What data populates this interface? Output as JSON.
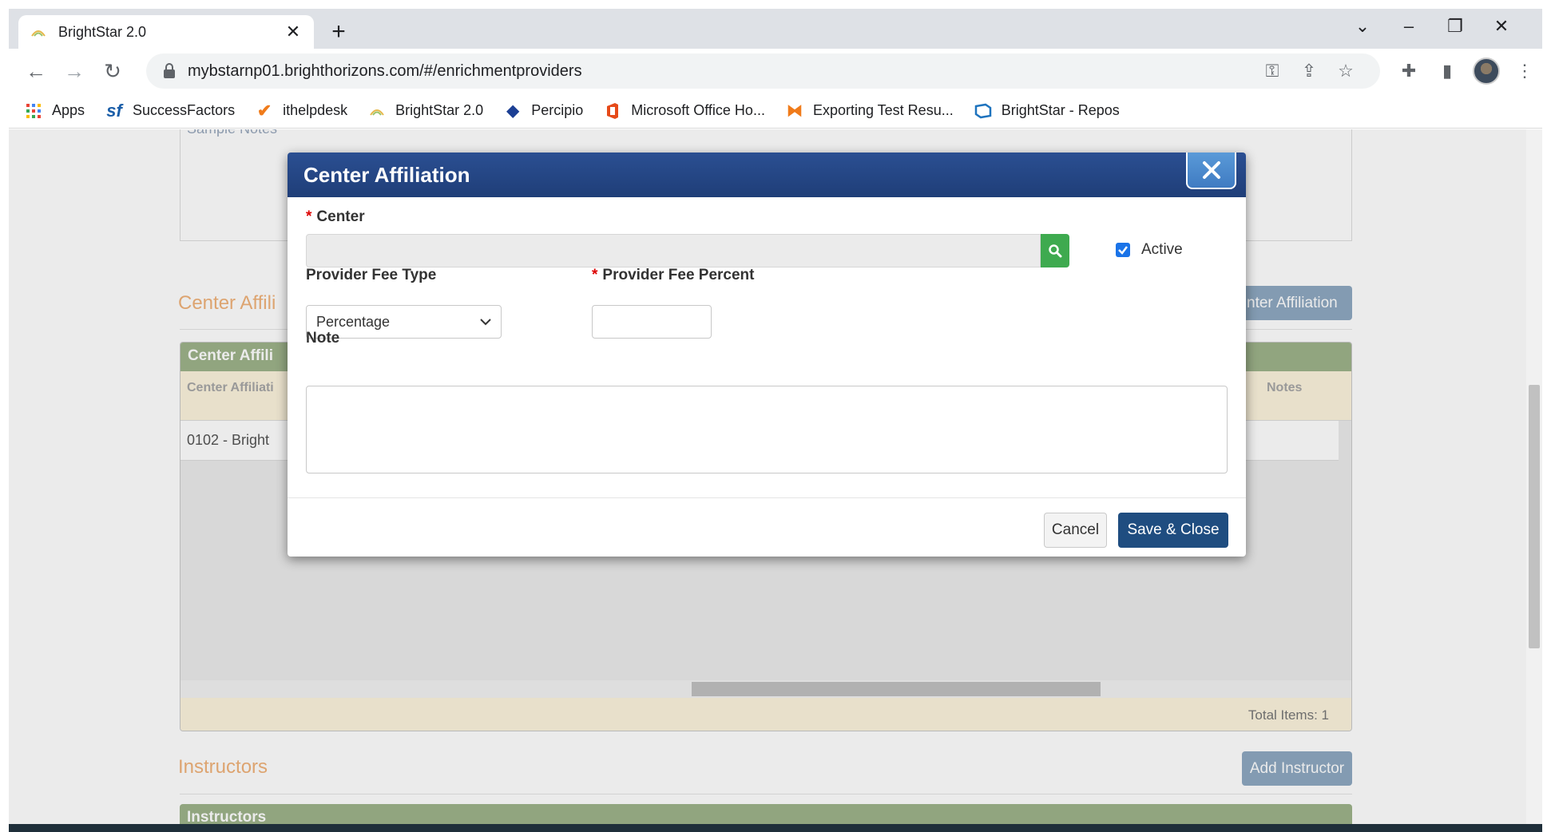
{
  "browser": {
    "tab_title": "BrightStar 2.0",
    "url": "mybstarnp01.brighthorizons.com/#/enrichmentproviders",
    "bookmarks": [
      {
        "label": "Apps",
        "icon": "apps-grid-icon"
      },
      {
        "label": "SuccessFactors",
        "icon": "sf-icon"
      },
      {
        "label": "ithelpdesk",
        "icon": "checkmark-icon"
      },
      {
        "label": "BrightStar 2.0",
        "icon": "brightstar-icon"
      },
      {
        "label": "Percipio",
        "icon": "percipio-icon"
      },
      {
        "label": "Microsoft Office Ho...",
        "icon": "office-icon"
      },
      {
        "label": "Exporting Test Resu...",
        "icon": "exporting-icon"
      },
      {
        "label": "BrightStar - Repos",
        "icon": "azure-repos-icon"
      }
    ]
  },
  "page": {
    "notes_placeholder": "Sample Notes",
    "center_affiliation_section": "Center Affili",
    "add_center_affiliation_button": "nter Affiliation",
    "grid_title": "Center Affili",
    "grid_col_center": "Center Affiliati",
    "grid_col_notes": "Notes",
    "grid_rows": [
      {
        "center": "0102 - Bright"
      }
    ],
    "total_items": "Total Items: 1",
    "instructors_section": "Instructors",
    "add_instructor_button": "Add Instructor",
    "instructors_grid_title": "Instructors"
  },
  "modal": {
    "title": "Center Affiliation",
    "center_label": "Center",
    "active_label": "Active",
    "active_checked": true,
    "provider_fee_type_label": "Provider Fee Type",
    "provider_fee_type_value": "Percentage",
    "provider_fee_percent_label": "Provider Fee Percent",
    "provider_fee_percent_value": "",
    "note_label": "Note",
    "note_value": "",
    "cancel_button": "Cancel",
    "save_button": "Save & Close"
  }
}
